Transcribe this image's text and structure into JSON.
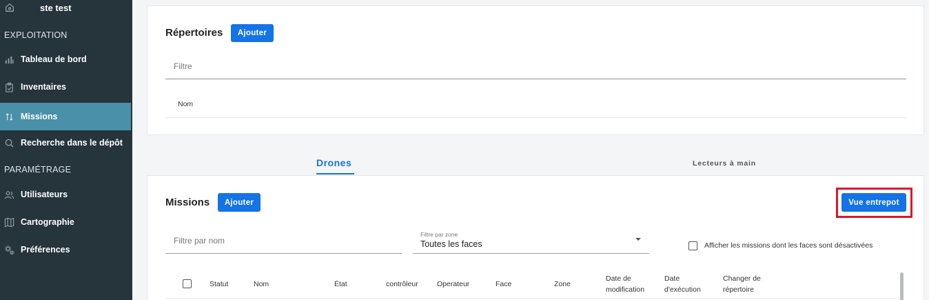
{
  "sidebar": {
    "site_name": "ste test",
    "sections": {
      "exploitation": "EXPLOITATION",
      "parametrage": "PARAMÉTRAGE"
    },
    "items": [
      {
        "label": "Tableau de bord",
        "icon": "bar-chart-icon"
      },
      {
        "label": "Inventaires",
        "icon": "clipboard-icon"
      },
      {
        "label": "Missions",
        "icon": "arrows-updown-icon",
        "active": true
      },
      {
        "label": "Recherche dans le dépôt",
        "icon": "search-icon"
      },
      {
        "label": "Utilisateurs",
        "icon": "users-icon"
      },
      {
        "label": "Cartographie",
        "icon": "map-icon"
      },
      {
        "label": "Préférences",
        "icon": "gears-icon"
      }
    ]
  },
  "repertoires": {
    "title": "Répertoires",
    "add_label": "Ajouter",
    "filter_placeholder": "Filtre",
    "column_name": "Nom"
  },
  "tabs": [
    {
      "label": "Drones",
      "active": true
    },
    {
      "label": "Lecteurs à main",
      "active": false
    }
  ],
  "missions": {
    "title": "Missions",
    "add_label": "Ajouter",
    "view_warehouse_label": "Vue entrepot",
    "filter_name_placeholder": "Filtre par nom",
    "zone_filter_label": "Filtre par zone",
    "zone_filter_value": "Toutes les faces",
    "show_disabled_label": "Afficher les missions dont les faces sont désactivées",
    "columns": [
      "Statut",
      "Nom",
      "État",
      "contrôleur",
      "Operateur",
      "Face",
      "Zone",
      "Date de modification",
      "Date d'exécution",
      "Changer de répertoire"
    ]
  },
  "colors": {
    "sidebar_bg": "#26343c",
    "active_item": "#4a90a8",
    "accent": "#1473e6",
    "highlight": "#e0142a"
  }
}
